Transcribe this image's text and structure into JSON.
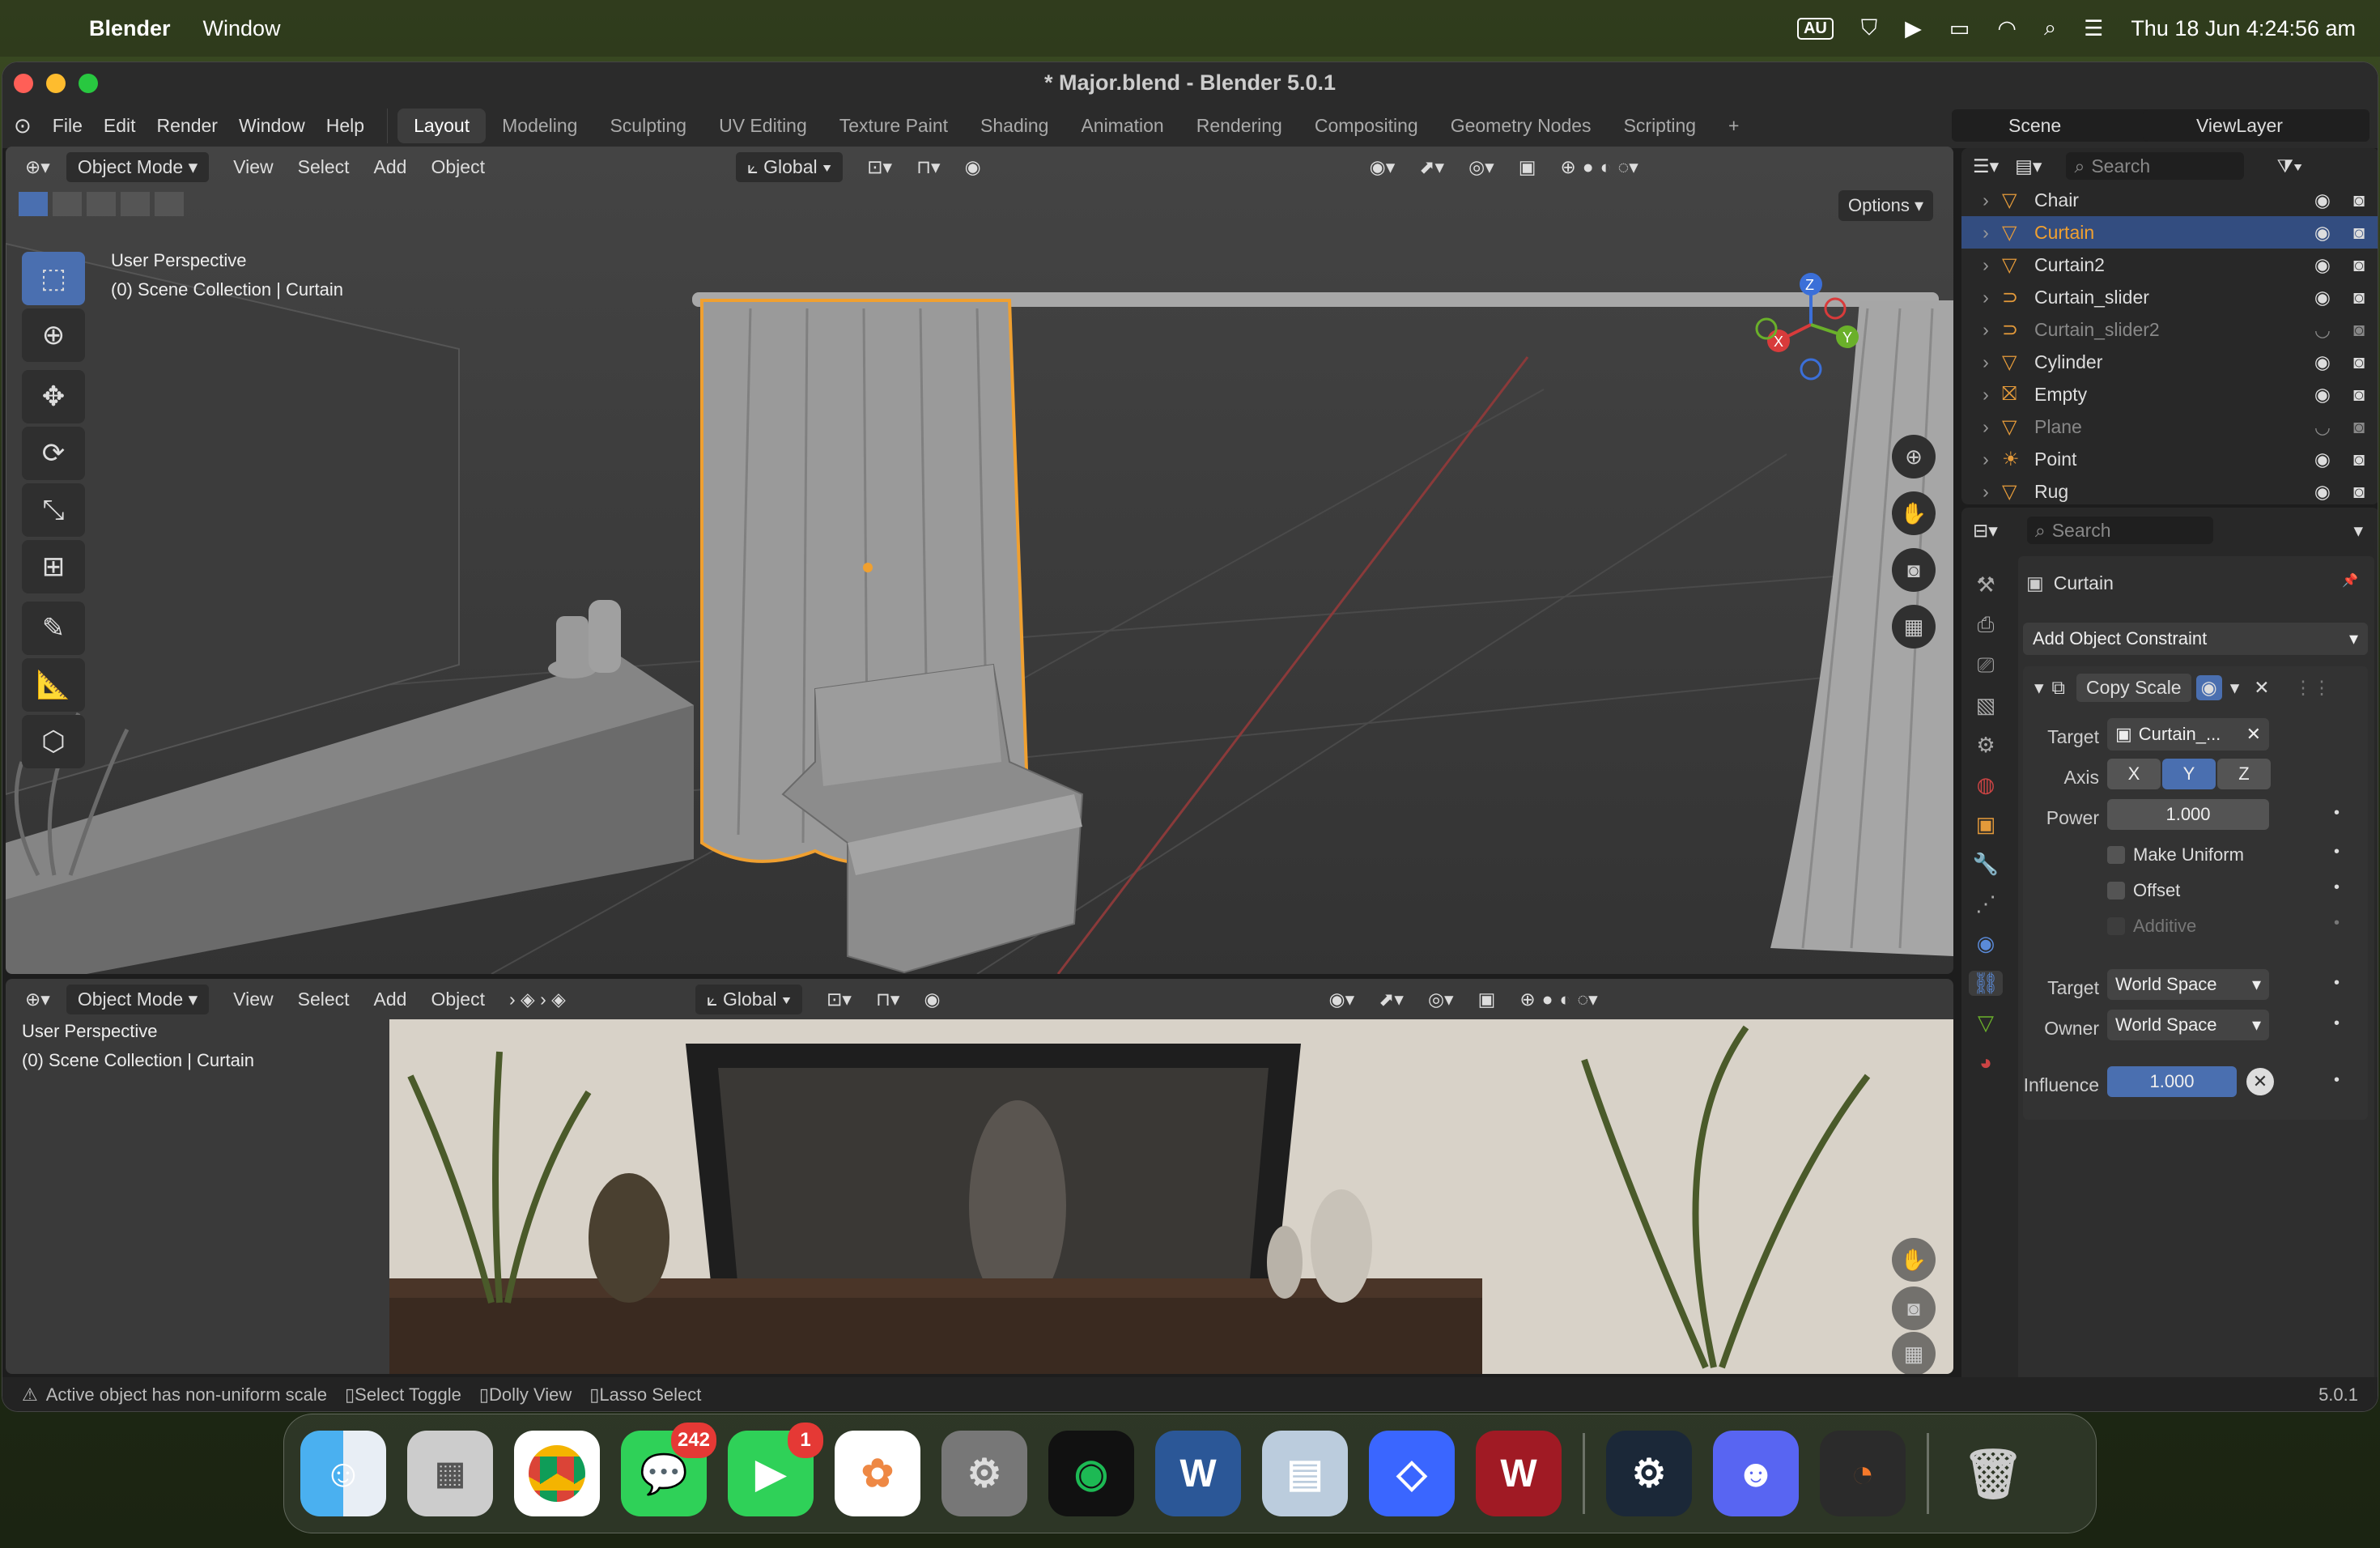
{
  "menubar": {
    "app_name": "Blender",
    "menu_window": "Window",
    "input_source": "AU",
    "datetime": "Thu 18 Jun  4:24:56 am"
  },
  "window": {
    "title": "* Major.blend - Blender 5.0.1"
  },
  "topbar": {
    "menus": [
      "File",
      "Edit",
      "Render",
      "Window",
      "Help"
    ],
    "workspaces": [
      "Layout",
      "Modeling",
      "Sculpting",
      "UV Editing",
      "Texture Paint",
      "Shading",
      "Animation",
      "Rendering",
      "Compositing",
      "Geometry Nodes",
      "Scripting"
    ],
    "active_workspace": "Layout",
    "scene": "Scene",
    "view_layer": "ViewLayer"
  },
  "viewport_top": {
    "mode": "Object Mode",
    "menus": [
      "View",
      "Select",
      "Add",
      "Object"
    ],
    "transform_orientation": "Global",
    "options_label": "Options",
    "overlay_line1": "User Perspective",
    "overlay_line2": "(0) Scene Collection | Curtain",
    "axis_labels": [
      "X",
      "Y",
      "Z"
    ]
  },
  "viewport_bottom": {
    "mode": "Object Mode",
    "menus": [
      "View",
      "Select",
      "Add",
      "Object"
    ],
    "transform_orientation": "Global",
    "overlay_line1": "User Perspective",
    "overlay_line2": "(0) Scene Collection | Curtain"
  },
  "outliner": {
    "search_placeholder": "Search",
    "items": [
      {
        "name": "Chair",
        "dim": false,
        "selected": false
      },
      {
        "name": "Curtain",
        "dim": false,
        "selected": true
      },
      {
        "name": "Curtain2",
        "dim": false,
        "selected": false
      },
      {
        "name": "Curtain_slider",
        "dim": false,
        "selected": false
      },
      {
        "name": "Curtain_slider2",
        "dim": true,
        "selected": false
      },
      {
        "name": "Cylinder",
        "dim": false,
        "selected": false
      },
      {
        "name": "Empty",
        "dim": false,
        "selected": false
      },
      {
        "name": "Plane",
        "dim": true,
        "selected": false
      },
      {
        "name": "Point",
        "dim": false,
        "selected": false
      },
      {
        "name": "Rug",
        "dim": false,
        "selected": false
      }
    ]
  },
  "properties": {
    "search_placeholder": "Search",
    "object_name": "Curtain",
    "add_constraint": "Add Object Constraint",
    "constraint_name": "Copy Scale",
    "target_label": "Target",
    "target_value": "Curtain_...",
    "axis_label": "Axis",
    "axes": [
      "X",
      "Y",
      "Z"
    ],
    "power_label": "Power",
    "power_value": "1.000",
    "make_uniform": "Make Uniform",
    "offset": "Offset",
    "additive": "Additive",
    "target_space_label": "Target",
    "target_space": "World Space",
    "owner_space_label": "Owner",
    "owner_space": "World Space",
    "influence_label": "Influence",
    "influence_value": "1.000"
  },
  "statusbar": {
    "warning": "Active object has non-uniform scale",
    "hint1": "Select Toggle",
    "hint2": "Dolly View",
    "hint3": "Lasso Select",
    "version": "5.0.1"
  },
  "dock": {
    "messages_badge": "242",
    "facetime_badge": "1"
  }
}
